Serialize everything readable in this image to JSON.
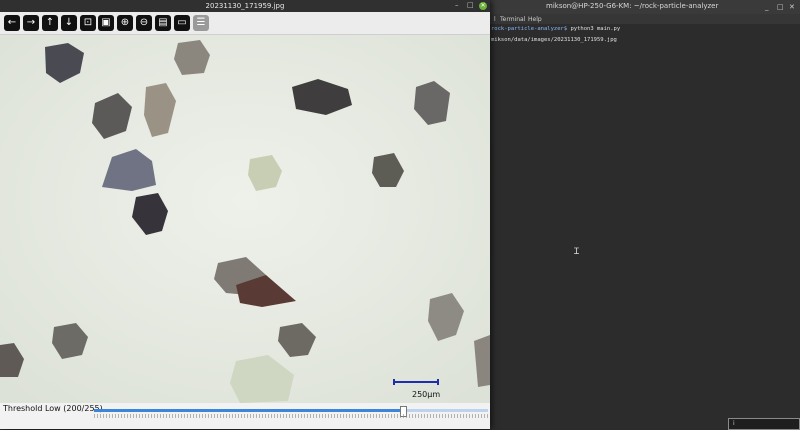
{
  "terminal": {
    "title": "mikson@HP-250-G6-KM: ~/rock-particle-analyzer",
    "menu": [
      "Terminal",
      "Help"
    ],
    "lines": [
      {
        "prompt": "rock-particle-analyzer$",
        "command": " python3 main.py"
      },
      {
        "prompt": "",
        "command": "mikson/data/images/20231130_171959.jpg"
      }
    ],
    "mini_box_text": "i"
  },
  "viewer": {
    "title": "20231130_171959.jpg",
    "toolbar": [
      {
        "name": "back-button",
        "icon": "arrow-left-icon",
        "glyph": "←"
      },
      {
        "name": "forward-button",
        "icon": "arrow-right-icon",
        "glyph": "→"
      },
      {
        "name": "up-button",
        "icon": "arrow-up-icon",
        "glyph": "↑"
      },
      {
        "name": "down-button",
        "icon": "arrow-down-icon",
        "glyph": "↓"
      },
      {
        "name": "fit-button",
        "icon": "fit-window-icon",
        "glyph": "⊡"
      },
      {
        "name": "image-button",
        "icon": "image-icon",
        "glyph": "▣"
      },
      {
        "name": "zoom-in-button",
        "icon": "zoom-in-icon",
        "glyph": "⊕"
      },
      {
        "name": "zoom-out-button",
        "icon": "zoom-out-icon",
        "glyph": "⊖"
      },
      {
        "name": "save-button",
        "icon": "save-icon",
        "glyph": "▤"
      },
      {
        "name": "window-button",
        "icon": "window-icon",
        "glyph": "▭"
      },
      {
        "name": "settings-button",
        "icon": "document-icon",
        "glyph": "☰"
      }
    ],
    "scale_label": "250µm",
    "status_label": "Threshold Low (200/255)",
    "threshold": {
      "value": 200,
      "max": 255
    }
  },
  "colors": {
    "accent": "#3b86d8",
    "scale_bar": "#1d2fb0",
    "close": "#6cb23b"
  }
}
